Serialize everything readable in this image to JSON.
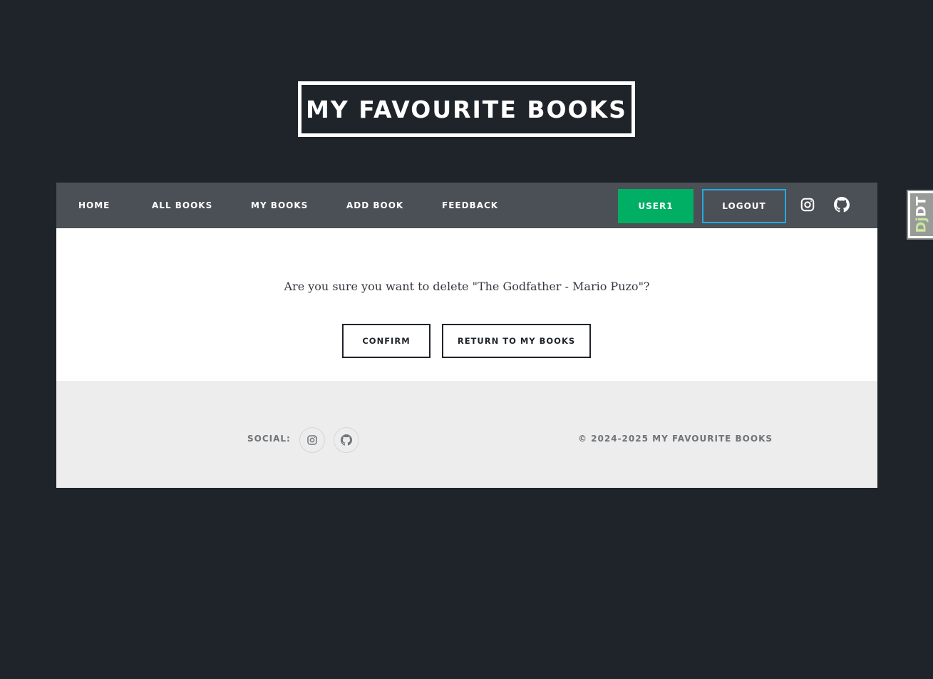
{
  "site": {
    "title": "MY FAVOURITE BOOKS"
  },
  "nav": {
    "items": [
      {
        "label": "HOME"
      },
      {
        "label": "ALL BOOKS"
      },
      {
        "label": "MY BOOKS"
      },
      {
        "label": "ADD BOOK"
      },
      {
        "label": "FEEDBACK"
      }
    ],
    "user_label": "USER1",
    "logout_label": "LOGOUT",
    "icons": [
      "instagram-icon",
      "github-icon"
    ]
  },
  "main": {
    "question": "Are you sure you want to delete \"The Godfather - Mario Puzo\"?",
    "confirm_label": "CONFIRM",
    "return_label": "RETURN TO MY BOOKS"
  },
  "footer": {
    "social_label": "SOCIAL:",
    "copyright": "© 2024-2025 MY FAVOURITE BOOKS"
  },
  "debug_toolbar": {
    "label_dj": "Dj",
    "label_dt": "DT"
  },
  "colors": {
    "background": "#1f242b",
    "navbar": "#4b4f56",
    "user_button": "#00af64",
    "logout_border": "#29a8df",
    "footer": "#ededed"
  }
}
